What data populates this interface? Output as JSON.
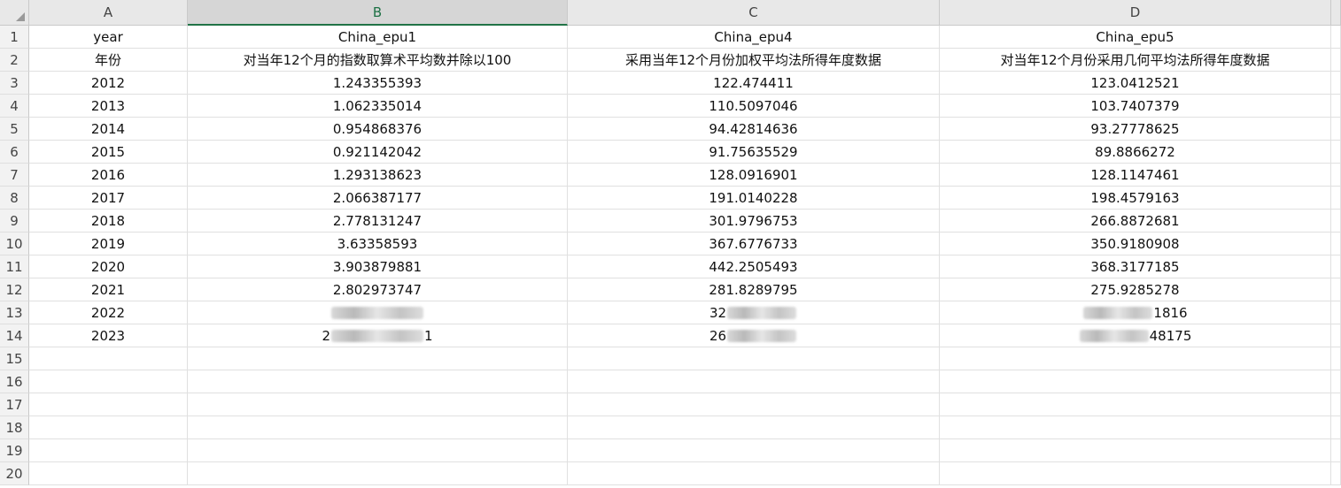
{
  "columns": [
    {
      "letter": "A",
      "active": false
    },
    {
      "letter": "B",
      "active": true
    },
    {
      "letter": "C",
      "active": false
    },
    {
      "letter": "D",
      "active": false
    }
  ],
  "row_numbers": [
    "1",
    "2",
    "3",
    "4",
    "5",
    "6",
    "7",
    "8",
    "9",
    "10",
    "11",
    "12",
    "13",
    "14",
    "15",
    "16",
    "17",
    "18",
    "19",
    "20"
  ],
  "rows": [
    [
      "year",
      "China_epu1",
      "China_epu4",
      "China_epu5"
    ],
    [
      "年份",
      "对当年12个月的指数取算术平均数并除以100",
      "采用当年12个月份加权平均法所得年度数据",
      "对当年12个月份采用几何平均法所得年度数据"
    ],
    [
      "2012",
      "1.243355393",
      "122.474411",
      "123.0412521"
    ],
    [
      "2013",
      "1.062335014",
      "110.5097046",
      "103.7407379"
    ],
    [
      "2014",
      "0.954868376",
      "94.42814636",
      "93.27778625"
    ],
    [
      "2015",
      "0.921142042",
      "91.75635529",
      "89.8866272"
    ],
    [
      "2016",
      "1.293138623",
      "128.0916901",
      "128.1147461"
    ],
    [
      "2017",
      "2.066387177",
      "191.0140228",
      "198.4579163"
    ],
    [
      "2018",
      "2.778131247",
      "301.9796753",
      "266.8872681"
    ],
    [
      "2019",
      "3.63358593",
      "367.6776733",
      "350.9180908"
    ],
    [
      "2020",
      "3.903879881",
      "442.2505493",
      "368.3177185"
    ],
    [
      "2021",
      "2.802973747",
      "281.8289795",
      "275.9285278"
    ],
    [
      "2022",
      "",
      "32",
      "1816"
    ],
    [
      "2023",
      "2",
      "26",
      "48175"
    ]
  ],
  "redacted": {
    "r13b": {
      "before": "",
      "after": ""
    },
    "r13c": {
      "before": "32",
      "after": ""
    },
    "r13d": {
      "before": "",
      "after": "1816"
    },
    "r14b": {
      "before": "2",
      "after": "1"
    },
    "r14c": {
      "before": "26",
      "after": ""
    },
    "r14d": {
      "before": "",
      "after": "48175"
    }
  }
}
